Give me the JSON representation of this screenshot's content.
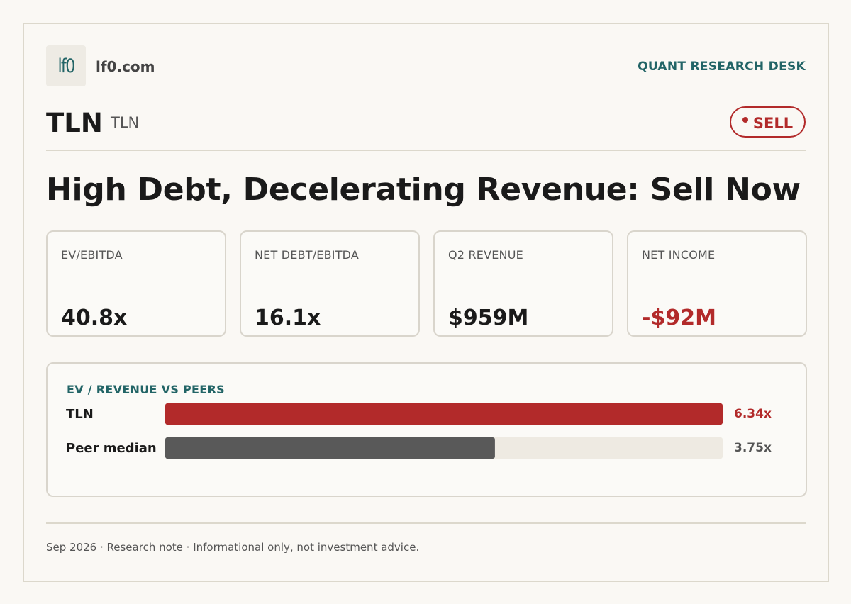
{
  "brand": {
    "logo_text": "lf0",
    "site": "lf0.com",
    "desk": "QUANT RESEARCH DESK"
  },
  "ticker": {
    "symbol": "TLN",
    "sub": "TLN",
    "rating": "SELL"
  },
  "headline": "High Debt, Decelerating Revenue: Sell Now",
  "metrics": [
    {
      "label": "EV/EBITDA",
      "value": "40.8x"
    },
    {
      "label": "NET DEBT/EBITDA",
      "value": "16.1x"
    },
    {
      "label": "Q2 REVENUE",
      "value": "$959M"
    },
    {
      "label": "NET INCOME",
      "value": "-$92M"
    }
  ],
  "colors": {
    "accent": "#226466",
    "negative": "#b22a2a",
    "peer": "#595959",
    "track": "#eeeae2"
  },
  "chart_data": {
    "type": "bar",
    "orientation": "horizontal",
    "title": "EV / REVENUE VS PEERS",
    "categories": [
      "TLN",
      "Peer median"
    ],
    "values": [
      6.34,
      3.75
    ],
    "value_labels": [
      "6.34x",
      "3.75x"
    ],
    "xlim": [
      0,
      6.34
    ],
    "grid": false,
    "legend": "none"
  },
  "footer": "Sep 2026 · Research note · Informational only, not investment advice."
}
